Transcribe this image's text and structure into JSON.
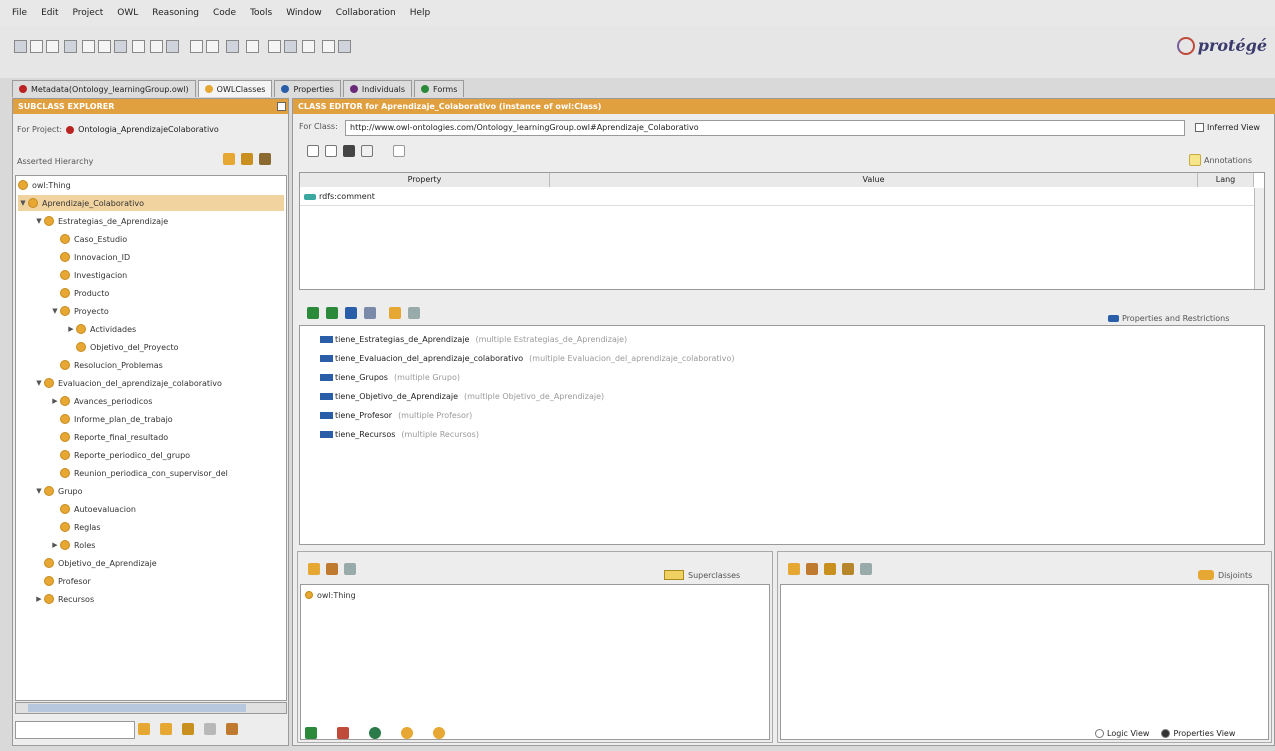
{
  "menu": [
    "File",
    "Edit",
    "Project",
    "OWL",
    "Reasoning",
    "Code",
    "Tools",
    "Window",
    "Collaboration",
    "Help"
  ],
  "logo": {
    "text": "protégé"
  },
  "tabs": [
    {
      "label": "Metadata(Ontology_learningGroup.owl)",
      "color": "#b22"
    },
    {
      "label": "OWLClasses",
      "color": "#e6a733"
    },
    {
      "label": "Properties",
      "color": "#2a5ea8"
    },
    {
      "label": "Individuals",
      "color": "#6a2a7a"
    },
    {
      "label": "Forms",
      "color": "#2a8a3a"
    }
  ],
  "subclass_explorer": {
    "header": "SUBCLASS EXPLORER",
    "for_project_label": "For Project:",
    "project_name": "Ontologia_AprendizajeColaborativo",
    "hierarchy_label": "Asserted Hierarchy",
    "tree": [
      {
        "label": "owl:Thing",
        "level": 0,
        "toggle": "",
        "selected": false
      },
      {
        "label": "Aprendizaje_Colaborativo",
        "level": 0,
        "toggle": "▼",
        "selected": true
      },
      {
        "label": "Estrategias_de_Aprendizaje",
        "level": 1,
        "toggle": "▼",
        "selected": false
      },
      {
        "label": "Caso_Estudio",
        "level": 2,
        "toggle": "",
        "selected": false
      },
      {
        "label": "Innovacion_ID",
        "level": 2,
        "toggle": "",
        "selected": false
      },
      {
        "label": "Investigacion",
        "level": 2,
        "toggle": "",
        "selected": false
      },
      {
        "label": "Producto",
        "level": 2,
        "toggle": "",
        "selected": false
      },
      {
        "label": "Proyecto",
        "level": 2,
        "toggle": "▼",
        "selected": false
      },
      {
        "label": "Actividades",
        "level": 3,
        "toggle": "▶",
        "selected": false
      },
      {
        "label": "Objetivo_del_Proyecto",
        "level": 3,
        "toggle": "",
        "selected": false
      },
      {
        "label": "Resolucion_Problemas",
        "level": 2,
        "toggle": "",
        "selected": false
      },
      {
        "label": "Evaluacion_del_aprendizaje_colaborativo",
        "level": 1,
        "toggle": "▼",
        "selected": false
      },
      {
        "label": "Avances_periodicos",
        "level": 2,
        "toggle": "▶",
        "selected": false
      },
      {
        "label": "Informe_plan_de_trabajo",
        "level": 2,
        "toggle": "",
        "selected": false
      },
      {
        "label": "Reporte_final_resultado",
        "level": 2,
        "toggle": "",
        "selected": false
      },
      {
        "label": "Reporte_periodico_del_grupo",
        "level": 2,
        "toggle": "",
        "selected": false
      },
      {
        "label": "Reunion_periodica_con_supervisor_del",
        "level": 2,
        "toggle": "",
        "selected": false
      },
      {
        "label": "Grupo",
        "level": 1,
        "toggle": "▼",
        "selected": false
      },
      {
        "label": "Autoevaluacion",
        "level": 2,
        "toggle": "",
        "selected": false
      },
      {
        "label": "Reglas",
        "level": 2,
        "toggle": "",
        "selected": false
      },
      {
        "label": "Roles",
        "level": 2,
        "toggle": "▶",
        "selected": false
      },
      {
        "label": "Objetivo_de_Aprendizaje",
        "level": 1,
        "toggle": "",
        "selected": false
      },
      {
        "label": "Profesor",
        "level": 1,
        "toggle": "",
        "selected": false
      },
      {
        "label": "Recursos",
        "level": 1,
        "toggle": "▶",
        "selected": false
      }
    ]
  },
  "class_editor": {
    "header": "CLASS EDITOR for Aprendizaje_Colaborativo   (instance of owl:Class)",
    "for_class_label": "For Class:",
    "class_uri": "http://www.owl-ontologies.com/Ontology_learningGroup.owl#Aprendizaje_Colaborativo",
    "inferred_view_label": "Inferred View",
    "annotations_label": "Annotations",
    "table_headers": [
      "Property",
      "Value",
      "Lang"
    ],
    "annotation_rows": [
      {
        "property": "rdfs:comment",
        "value": "",
        "lang": ""
      }
    ],
    "properties_label": "Properties and Restrictions",
    "properties": [
      {
        "name": "tiene_Estrategias_de_Aprendizaje",
        "note": "(multiple Estrategias_de_Aprendizaje)"
      },
      {
        "name": "tiene_Evaluacion_del_aprendizaje_colaborativo",
        "note": "(multiple Evaluacion_del_aprendizaje_colaborativo)"
      },
      {
        "name": "tiene_Grupos",
        "note": "(multiple Grupo)"
      },
      {
        "name": "tiene_Objetivo_de_Aprendizaje",
        "note": "(multiple Objetivo_de_Aprendizaje)"
      },
      {
        "name": "tiene_Profesor",
        "note": "(multiple Profesor)"
      },
      {
        "name": "tiene_Recursos",
        "note": "(multiple Recursos)"
      }
    ],
    "superclasses_label": "Superclasses",
    "superclasses": [
      "owl:Thing"
    ],
    "disjoints_label": "Disjoints",
    "logic_view_label": "Logic View",
    "properties_view_label": "Properties View"
  }
}
